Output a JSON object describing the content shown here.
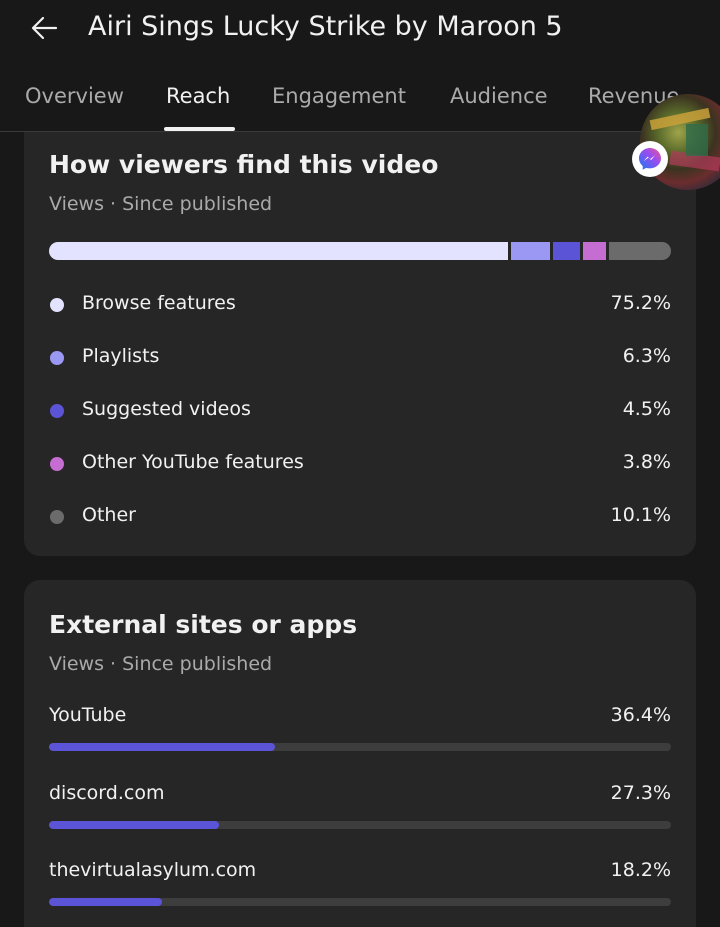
{
  "header": {
    "title": "Airi Sings Lucky Strike by Maroon 5",
    "back_icon": "arrow-left-icon"
  },
  "tabs": [
    {
      "label": "Overview",
      "active": false
    },
    {
      "label": "Reach",
      "active": true
    },
    {
      "label": "Engagement",
      "active": false
    },
    {
      "label": "Audience",
      "active": false
    },
    {
      "label": "Revenue",
      "active": false
    }
  ],
  "overlay": {
    "bubble_icon": "chat-head-avatar",
    "badge_icon": "messenger-icon"
  },
  "traffic_sources": {
    "title": "How viewers find this video",
    "subtitle": "Views · Since published",
    "items": [
      {
        "label": "Browse features",
        "value": "75.2%",
        "percent": 75.2,
        "color": "#e4e3ff"
      },
      {
        "label": "Playlists",
        "value": "6.3%",
        "percent": 6.3,
        "color": "#9b98f4"
      },
      {
        "label": "Suggested videos",
        "value": "4.5%",
        "percent": 4.5,
        "color": "#5b54d6"
      },
      {
        "label": "Other YouTube features",
        "value": "3.8%",
        "percent": 3.8,
        "color": "#c66dd1"
      },
      {
        "label": "Other",
        "value": "10.1%",
        "percent": 10.1,
        "color": "#6b6b6b"
      }
    ]
  },
  "external_sites": {
    "title": "External sites or apps",
    "subtitle": "Views · Since published",
    "items": [
      {
        "label": "YouTube",
        "value": "36.4%",
        "percent": 36.4
      },
      {
        "label": "discord.com",
        "value": "27.3%",
        "percent": 27.3
      },
      {
        "label": "thevirtualasylum.com",
        "value": "18.2%",
        "percent": 18.2
      }
    ],
    "bar_color": "#5b54d6"
  }
}
